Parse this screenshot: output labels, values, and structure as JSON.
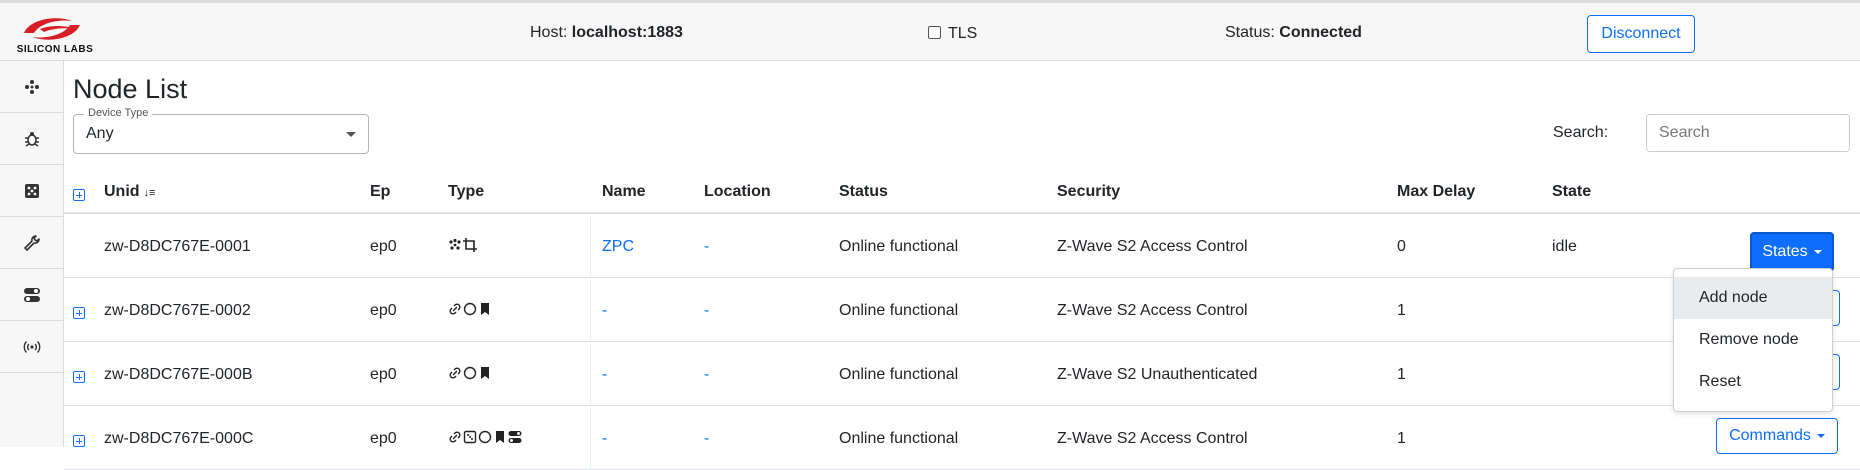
{
  "header": {
    "logo_text": "SILICON LABS",
    "host_label": "Host:",
    "host_value": "localhost:1883",
    "tls_label": "TLS",
    "status_label": "Status:",
    "status_value": "Connected",
    "disconnect_label": "Disconnect"
  },
  "sidebar": {
    "items": [
      {
        "icon": "network-icon"
      },
      {
        "icon": "bug-icon"
      },
      {
        "icon": "dice-icon"
      },
      {
        "icon": "wrench-icon"
      },
      {
        "icon": "toggle-icon"
      },
      {
        "icon": "signal-icon"
      }
    ]
  },
  "main": {
    "title": "Node List",
    "device_type": {
      "legend": "Device Type",
      "value": "Any"
    },
    "search": {
      "label": "Search:",
      "placeholder": "Search"
    }
  },
  "table": {
    "headers": {
      "unid": "Unid",
      "ep": "Ep",
      "type": "Type",
      "name": "Name",
      "location": "Location",
      "status": "Status",
      "security": "Security",
      "max_delay": "Max Delay",
      "state": "State"
    },
    "rows": [
      {
        "unid": "zw-D8DC767E-0001",
        "ep": "ep0",
        "name": "ZPC",
        "location": "-",
        "status": "Online functional",
        "security": "Z-Wave S2 Access Control",
        "max_delay": "0",
        "state": "idle"
      },
      {
        "unid": "zw-D8DC767E-0002",
        "ep": "ep0",
        "name": "-",
        "location": "-",
        "status": "Online functional",
        "security": "Z-Wave S2 Access Control",
        "max_delay": "1",
        "state": ""
      },
      {
        "unid": "zw-D8DC767E-000B",
        "ep": "ep0",
        "name": "-",
        "location": "-",
        "status": "Online functional",
        "security": "Z-Wave S2 Unauthenticated",
        "max_delay": "1",
        "state": ""
      },
      {
        "unid": "zw-D8DC767E-000C",
        "ep": "ep0",
        "name": "-",
        "location": "-",
        "status": "Online functional",
        "security": "Z-Wave S2 Access Control",
        "max_delay": "1",
        "state": ""
      }
    ],
    "states_button": "States",
    "commands_button": "Commands"
  },
  "states_menu": {
    "items": [
      "Add node",
      "Remove node",
      "Reset"
    ]
  },
  "colors": {
    "accent": "#0d6efd",
    "logo_red": "#d71f26"
  }
}
